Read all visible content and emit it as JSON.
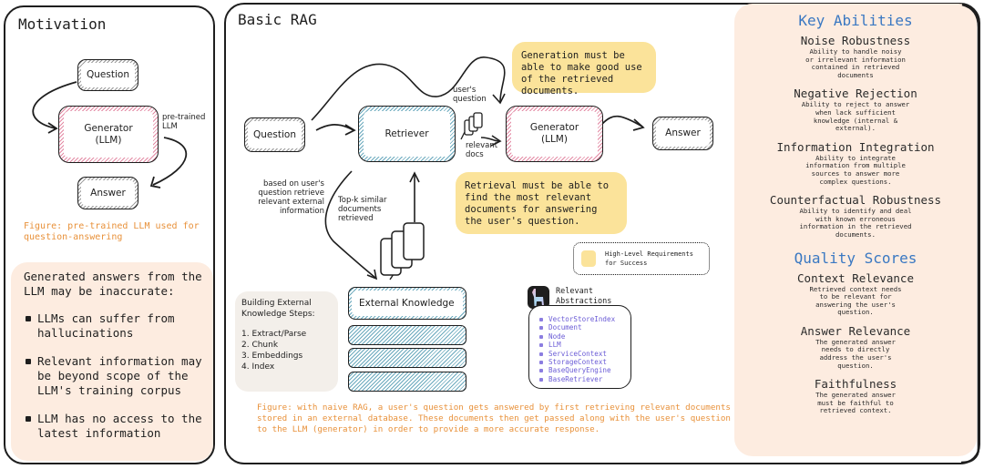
{
  "motivation": {
    "title": "Motivation",
    "nodes": {
      "question": "Question",
      "generator": "Generator (LLM)",
      "answer": "Answer"
    },
    "arrow_label": "pre-trained LLM",
    "figure_caption": "Figure: pre-trained LLM used for question-answering",
    "note": {
      "heading": "Generated answers from the LLM may be inaccurate:",
      "bullets": [
        "LLMs can suffer from hallucinations",
        "Relevant information may be beyond scope of the LLM's training corpus",
        "LLM has no access to the latest information"
      ]
    }
  },
  "basic_rag": {
    "title": "Basic RAG",
    "nodes": {
      "question": "Question",
      "retriever": "Retriever",
      "generator": "Generator (LLM)",
      "answer": "Answer",
      "external_knowledge": "External Knowledge"
    },
    "labels": {
      "users_question": "user's question",
      "relevant_docs": "relevant docs",
      "retrieve_info": "based on user's question retrieve relevant external information",
      "top_k": "Top-k similar documents retrieved"
    },
    "requirements": {
      "generation": "Generation must be able to make good use of the retrieved documents.",
      "retrieval": "Retrieval must be able to find the most relevant documents for answering the user's question."
    },
    "legend": "High-Level Requirements for Success",
    "steps": {
      "heading": "Building External Knowledge Steps:",
      "items": [
        "1. Extract/Parse",
        "2. Chunk",
        "3. Embeddings",
        "4. Index"
      ]
    },
    "abstractions": {
      "title": "Relevant Abstractions",
      "items": [
        "VectorStoreIndex",
        "Document",
        "Node",
        "LLM",
        "ServiceContext",
        "StorageContext",
        "BaseQueryEngine",
        "BaseRetriever"
      ]
    },
    "figure_caption": "Figure: with naive RAG, a user's question gets answered by first retrieving relevant documents stored in an external database. These documents then get passed along with the user's question to the LLM (generator) in order to provide a more accurate response."
  },
  "key_abilities": {
    "title": "Key Abilities",
    "items": [
      {
        "title": "Noise Robustness",
        "desc": "Ability to handle noisy or irrelevant information contained in retrieved documents"
      },
      {
        "title": "Negative Rejection",
        "desc": "Ability to reject to answer when lack sufficient knowledge (internal & external)."
      },
      {
        "title": "Information Integration",
        "desc": "Ability to integrate information from multiple sources to answer more complex questions."
      },
      {
        "title": "Counterfactual Robustness",
        "desc": "Ability to identify and deal with known erroneous information in the retrieved documents."
      }
    ]
  },
  "quality_scores": {
    "title": "Quality Scores",
    "items": [
      {
        "title": "Context Relevance",
        "desc": "Retrieved context needs to be relevant for answering the user's question."
      },
      {
        "title": "Answer Relevance",
        "desc": "The generated answer needs to directly address the user's question."
      },
      {
        "title": "Faithfulness",
        "desc": "The generated answer must be faithful to retrieved context."
      }
    ]
  },
  "colors": {
    "caption_orange": "#e8913a",
    "requirement_yellow": "#fbe39a",
    "section_blue": "#3a78c2",
    "note_peach": "#fdece0",
    "abstraction_purple": "#6b5cd6",
    "generator_pink": "#e38aa4",
    "retriever_blue": "#6aa9bd"
  }
}
